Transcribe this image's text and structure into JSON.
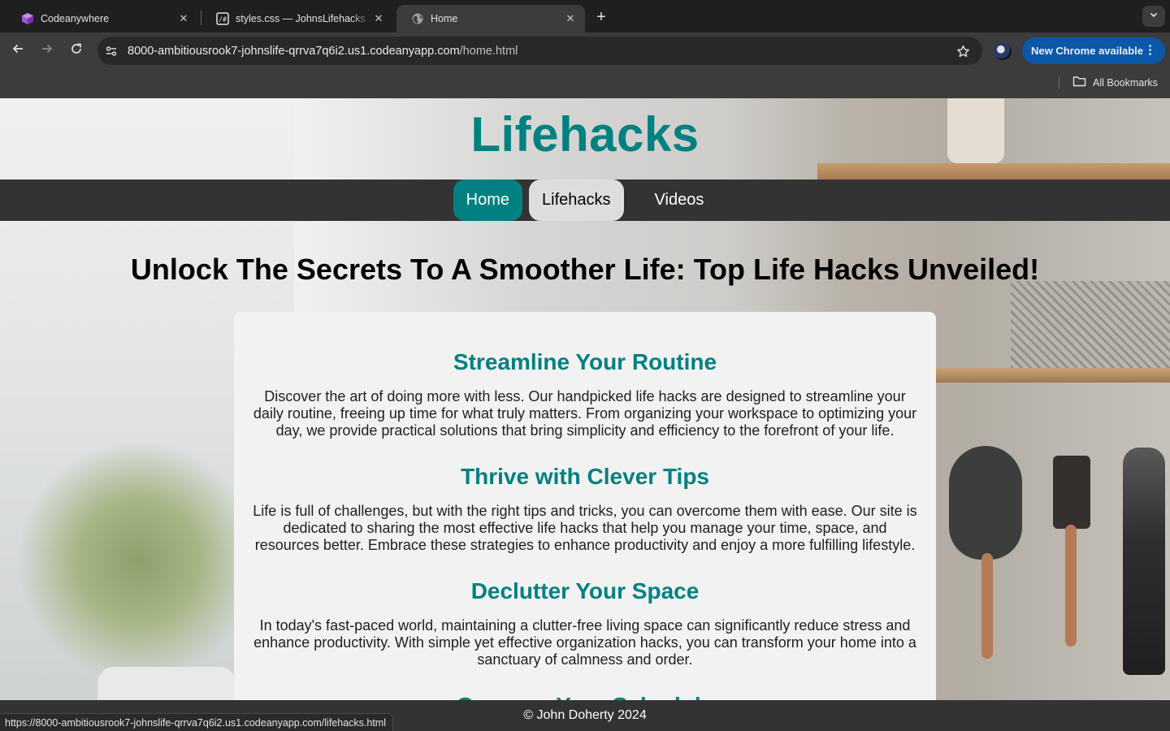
{
  "browser": {
    "tabs": [
      {
        "title": "Codeanywhere",
        "favicon": "codeanywhere-cube-icon",
        "active": false
      },
      {
        "title": "styles.css — JohnsLifehacks",
        "favicon": "code-file-icon",
        "active": false
      },
      {
        "title": "Home",
        "favicon": "globe-icon",
        "active": true
      }
    ],
    "close_glyph": "✕",
    "new_tab_glyph": "+",
    "url_host": "8000-ambitiousrook7-johnslife-qrrva7q6i2.us1.codeanyapp.com",
    "url_path": "/home.html",
    "update_button": "New Chrome available",
    "update_menu_glyph": "⋮",
    "bookmarks_label": "All Bookmarks",
    "status_url": "https://8000-ambitiousrook7-johnslife-qrrva7q6i2.us1.codeanyapp.com/lifehacks.html"
  },
  "site": {
    "title": "Lifehacks",
    "nav": [
      {
        "label": "Home",
        "state": "current"
      },
      {
        "label": "Lifehacks",
        "state": "hover"
      },
      {
        "label": "Videos",
        "state": "normal"
      }
    ],
    "headline": "Unlock The Secrets To A Smoother Life: Top Life Hacks Unveiled!",
    "sections": [
      {
        "title": "Streamline Your Routine",
        "text": "Discover the art of doing more with less. Our handpicked life hacks are designed to streamline your daily routine, freeing up time for what truly matters. From organizing your workspace to optimizing your day, we provide practical solutions that bring simplicity and efficiency to the forefront of your life."
      },
      {
        "title": "Thrive with Clever Tips",
        "text": "Life is full of challenges, but with the right tips and tricks, you can overcome them with ease. Our site is dedicated to sharing the most effective life hacks that help you manage your time, space, and resources better. Embrace these strategies to enhance productivity and enjoy a more fulfilling lifestyle."
      },
      {
        "title": "Declutter Your Space",
        "text": "In today's fast-paced world, maintaining a clutter-free living space can significantly reduce stress and enhance productivity. With simple yet effective organization hacks, you can transform your home into a sanctuary of calmness and order."
      },
      {
        "title": "Conquer Your Schedule",
        "text": ""
      }
    ],
    "footer": "© John Doherty 2024"
  },
  "colors": {
    "accent_teal": "#008080",
    "nav_bar": "#333333",
    "card_bg": "#f2f2f2",
    "chrome_update_blue": "#0b57a8"
  }
}
